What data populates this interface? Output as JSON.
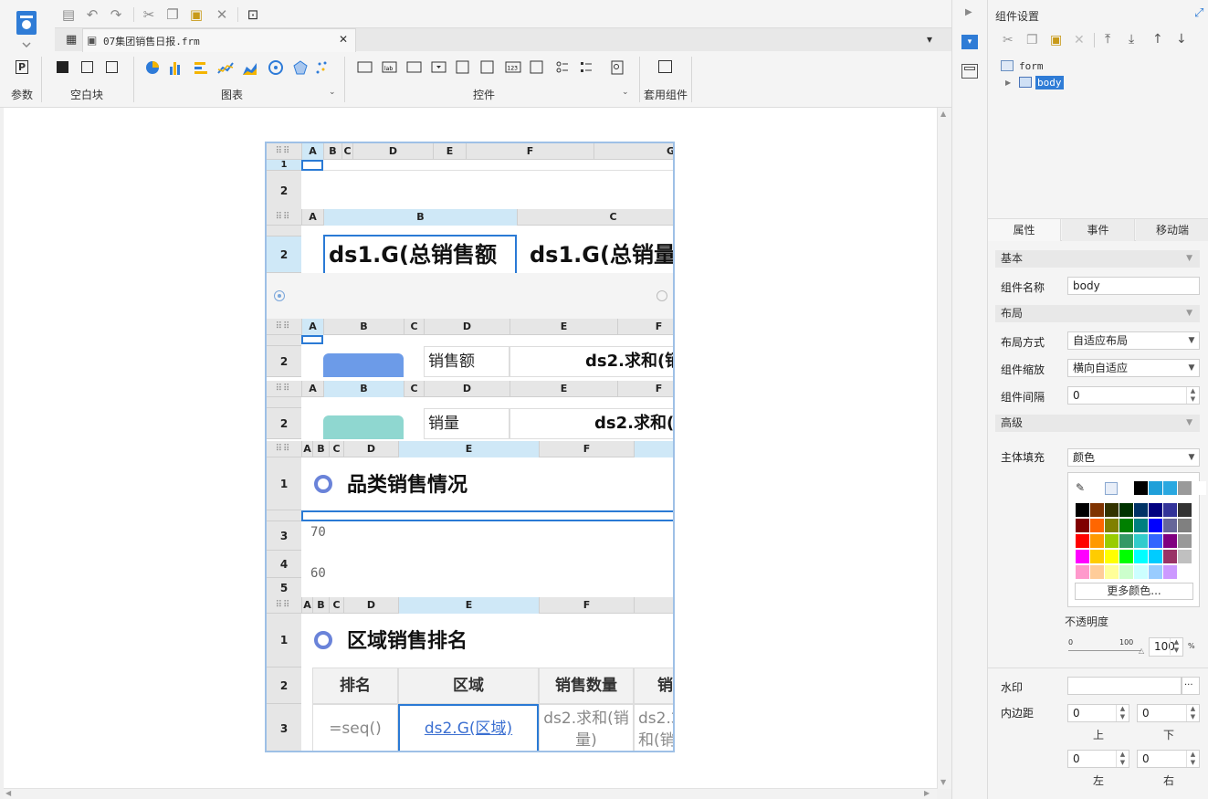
{
  "file_tab": {
    "title": "07集团销售日报.frm"
  },
  "toolbar_groups": {
    "params": "参数",
    "blank": "空白块",
    "chart": "图表",
    "widget": "控件",
    "suite": "套用组件"
  },
  "form": {
    "block1": {
      "cols": [
        "A",
        "B",
        "C",
        "D",
        "E",
        "F",
        "G"
      ],
      "rows": [
        "1",
        "2"
      ]
    },
    "block2": {
      "cols": [
        "A",
        "B",
        "C"
      ],
      "row": "2",
      "cell_b": "ds1.G(总销售额",
      "cell_c": "ds1.G(总销量"
    },
    "block3": {
      "cols": [
        "A",
        "B",
        "C",
        "D",
        "E",
        "F"
      ],
      "row": "2",
      "label": "销售额",
      "value": "ds2.求和(销"
    },
    "block4": {
      "cols": [
        "A",
        "B",
        "C",
        "D",
        "E",
        "F"
      ],
      "row": "2",
      "label": "销量",
      "value": "ds2.求和("
    },
    "block5": {
      "cols": [
        "A",
        "B",
        "C",
        "D",
        "E",
        "F"
      ],
      "rows": [
        "1",
        "3",
        "4",
        "5"
      ],
      "title": "品类销售情况",
      "axis_ticks": [
        "70",
        "60"
      ]
    },
    "block6": {
      "cols": [
        "A",
        "B",
        "C",
        "D",
        "E",
        "F"
      ],
      "rows": [
        "1",
        "2",
        "3"
      ],
      "title": "区域销售排名",
      "headers": [
        "排名",
        "区域",
        "销售数量",
        "销"
      ],
      "cells": [
        "=seq()",
        "ds2.G(区域)",
        "ds2.求和(销\n量)",
        "ds2.求和(销\n售"
      ]
    }
  },
  "panel": {
    "title": "组件设置",
    "tree": {
      "root": "form",
      "child": "body"
    },
    "tabs": [
      "属性",
      "事件",
      "移动端"
    ],
    "basic": "基本",
    "name_label": "组件名称",
    "name_value": "body",
    "layout": "布局",
    "layout_mode_label": "布局方式",
    "layout_mode_value": "自适应布局",
    "scale_label": "组件缩放",
    "scale_value": "横向自适应",
    "gap_label": "组件间隔",
    "gap_value": "0",
    "advanced": "高级",
    "fill_label": "主体填充",
    "fill_value": "颜色",
    "more_colors": "更多颜色...",
    "opacity_label": "不透明度",
    "opacity_min": "0",
    "opacity_max": "100",
    "opacity_value": "100",
    "opacity_unit": "%",
    "watermark_label": "水印",
    "padding_label": "内边距",
    "pad_top": "0",
    "pad_bottom": "0",
    "pad_left": "0",
    "pad_right": "0",
    "pad_top_label": "上",
    "pad_bottom_label": "下",
    "pad_left_label": "左",
    "pad_right_label": "右"
  },
  "colors": {
    "accent": "#2a7ad5",
    "selection": "#cfe8f7",
    "ring": "#6a83d9"
  }
}
